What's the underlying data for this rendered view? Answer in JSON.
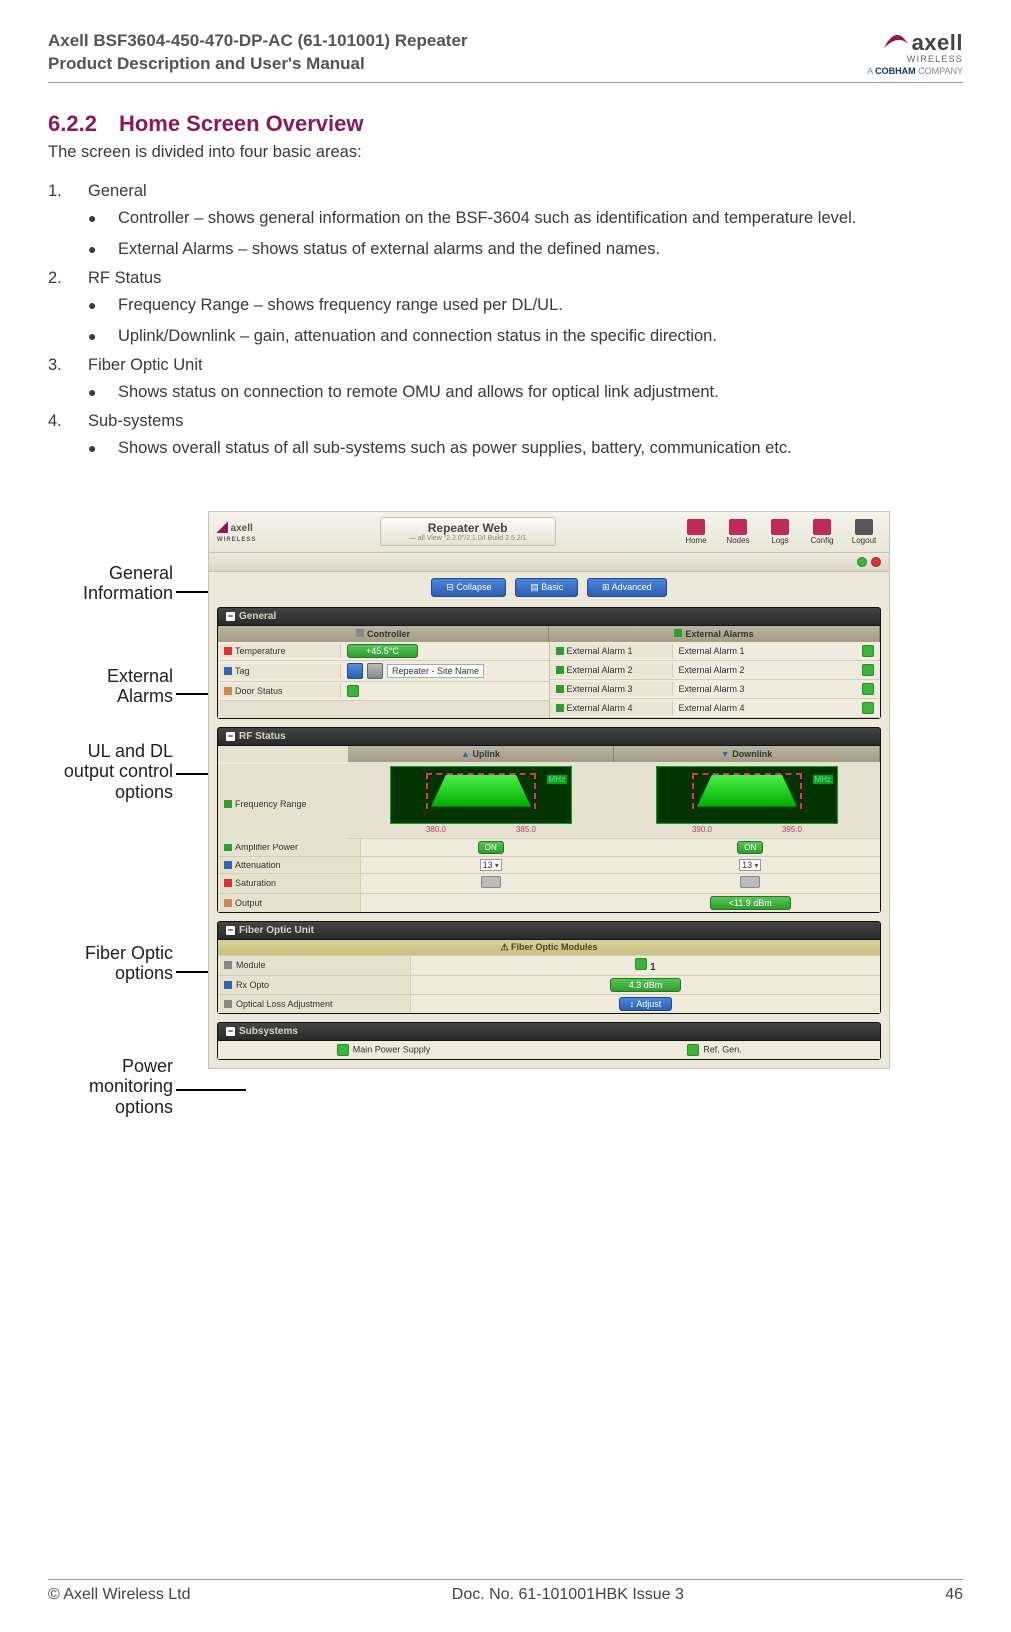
{
  "header": {
    "line1": "Axell BSF3604-450-470-DP-AC (61-101001) Repeater",
    "line2": "Product Description and User's Manual",
    "logo_main": "axell",
    "logo_sub": "WIRELESS",
    "logo_cobham_prefix": "A ",
    "logo_cobham_bold": "COBHAM",
    "logo_cobham_suffix": " COMPANY"
  },
  "section": {
    "number": "6.2.2",
    "title": "Home Screen Overview",
    "intro": "The screen is divided into four basic areas:"
  },
  "list": {
    "items": [
      {
        "num": "1.",
        "title": "General",
        "bullets": [
          "Controller – shows general information on the BSF-3604 such as identification and temperature level.",
          "External Alarms – shows status of external alarms and the defined names."
        ]
      },
      {
        "num": "2.",
        "title": "RF Status",
        "bullets": [
          "Frequency Range – shows frequency range used per DL/UL.",
          "Uplink/Downlink – gain, attenuation and connection status in the specific direction."
        ]
      },
      {
        "num": "3.",
        "title": "Fiber Optic Unit",
        "bullets": [
          "Shows status on connection to remote OMU and allows for optical link adjustment."
        ]
      },
      {
        "num": "4.",
        "title": "Sub-systems",
        "bullets": [
          "Shows overall status of all sub-systems such as power supplies, battery, communication etc."
        ]
      }
    ]
  },
  "callouts": {
    "c1": "General Information",
    "c1a": "General",
    "c1b": "Information",
    "c2a": "External",
    "c2b": "Alarms",
    "c3a": "UL and DL",
    "c3b": "output control",
    "c3c": "options",
    "c4a": "Fiber Optic",
    "c4b": "options",
    "c5a": "Power",
    "c5b": "monitoring",
    "c5c": "options"
  },
  "screenshot": {
    "appTitle": "Repeater Web",
    "nav": [
      "Home",
      "Nodes",
      "Logs",
      "Config",
      "Logout"
    ],
    "tabs": [
      "⊟ Collapse",
      "▤ Basic",
      "⊞ Advanced"
    ],
    "general": {
      "panel": "General",
      "left_head": "Controller",
      "right_head": "External Alarms",
      "temp_label": "Temperature",
      "temp_value": "+45.5°C",
      "tag_label": "Tag",
      "tag_value": "Repeater - Site Name",
      "door_label": "Door Status",
      "ea1_l": "External Alarm 1",
      "ea1_v": "External Alarm 1",
      "ea2_l": "External Alarm 2",
      "ea2_v": "External Alarm 2",
      "ea3_l": "External Alarm 3",
      "ea3_v": "External Alarm 3",
      "ea4_l": "External Alarm 4",
      "ea4_v": "External Alarm 4"
    },
    "rf": {
      "panel": "RF Status",
      "ul": "Uplink",
      "dl": "Downlink",
      "mhz": "MHz",
      "ul_f1": "380.0",
      "ul_f2": "385.0",
      "dl_f1": "390.0",
      "dl_f2": "395.0",
      "freq_label": "Frequency Range",
      "amp_label": "Amplifier Power",
      "amp_on": "ON",
      "att_label": "Attenuation",
      "att_val": "13",
      "sat_label": "Saturation",
      "out_label": "Output",
      "out_val": "<11.9 dBm"
    },
    "fo": {
      "panel": "Fiber Optic Unit",
      "strip": "Fiber Optic Modules",
      "mod_label": "Module",
      "mod_val": "1",
      "rx_label": "Rx Opto",
      "rx_val": "4.3 dBm",
      "adj_label": "Optical Loss Adjustment",
      "adj_btn": "Adjust"
    },
    "sub": {
      "panel": "Subsystems",
      "main": "Main Power Supply",
      "ref": "Ref. Gen."
    }
  },
  "footer": {
    "left": "© Axell Wireless Ltd",
    "center": "Doc. No. 61-101001HBK Issue 3",
    "right": "46"
  }
}
